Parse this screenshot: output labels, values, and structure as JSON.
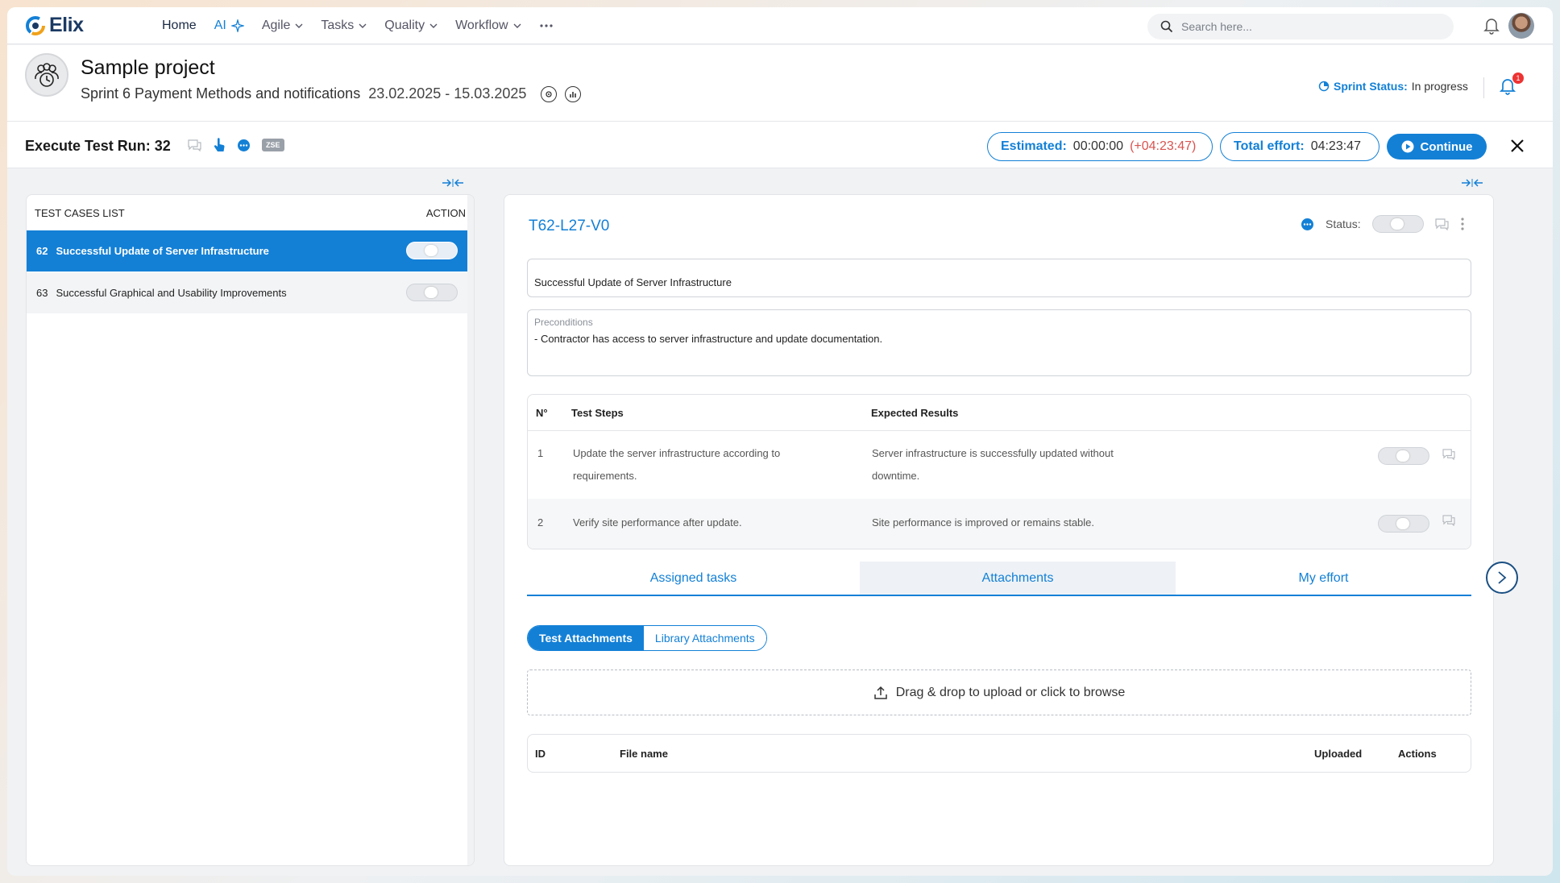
{
  "app": {
    "logo_text": "Elix",
    "brand_color": "#1380d6"
  },
  "nav": {
    "items": [
      {
        "label": "Home"
      },
      {
        "label": "AI"
      },
      {
        "label": "Agile"
      },
      {
        "label": "Tasks"
      },
      {
        "label": "Quality"
      },
      {
        "label": "Workflow"
      }
    ],
    "more_icon": "ellipsis-icon",
    "search_placeholder": "Search here..."
  },
  "project": {
    "title": "Sample project",
    "sprint_name": "Sprint 6 Payment Methods and notifications",
    "dates": "23.02.2025 - 15.03.2025",
    "sprint_status_label": "Sprint Status:",
    "sprint_status_value": "In progress",
    "notification_count": "1"
  },
  "run": {
    "title": "Execute Test Run: 32",
    "tag": "ZSE",
    "estimated_label": "Estimated:",
    "estimated_value": "00:00:00",
    "estimated_delta": "(+04:23:47)",
    "effort_label": "Total effort:",
    "effort_value": "04:23:47",
    "continue_label": "Continue"
  },
  "test_cases": {
    "header_left": "TEST CASES LIST",
    "header_right": "ACTION",
    "rows": [
      {
        "num": "62",
        "name": "Successful Update of Server Infrastructure",
        "selected": true
      },
      {
        "num": "63",
        "name": "Successful Graphical and Usability Improvements",
        "selected": false
      }
    ]
  },
  "detail": {
    "id": "T62-L27-V0",
    "status_label": "Status:",
    "title_value": "Successful Update of Server Infrastructure",
    "preconditions_label": "Preconditions",
    "preconditions_value": "- Contractor has access to server infrastructure and update documentation.",
    "steps_headers": {
      "num": "N°",
      "steps": "Test Steps",
      "expected": "Expected Results"
    },
    "steps": [
      {
        "num": "1",
        "step_line1": "Update the server infrastructure according to",
        "step_line2": "requirements.",
        "expected_line1": "Server infrastructure is successfully updated without",
        "expected_line2": "downtime."
      },
      {
        "num": "2",
        "step_line1": "Verify site performance after update.",
        "step_line2": "",
        "expected_line1": "Site performance is improved or remains stable.",
        "expected_line2": ""
      }
    ],
    "tabs": [
      "Assigned tasks",
      "Attachments",
      "My effort"
    ],
    "active_tab": "Attachments",
    "segments": [
      "Test Attachments",
      "Library Attachments"
    ],
    "dropzone_text": "Drag & drop to upload or click to browse",
    "attachments_headers": {
      "id": "ID",
      "file_name": "File name",
      "uploaded": "Uploaded",
      "actions": "Actions"
    }
  }
}
